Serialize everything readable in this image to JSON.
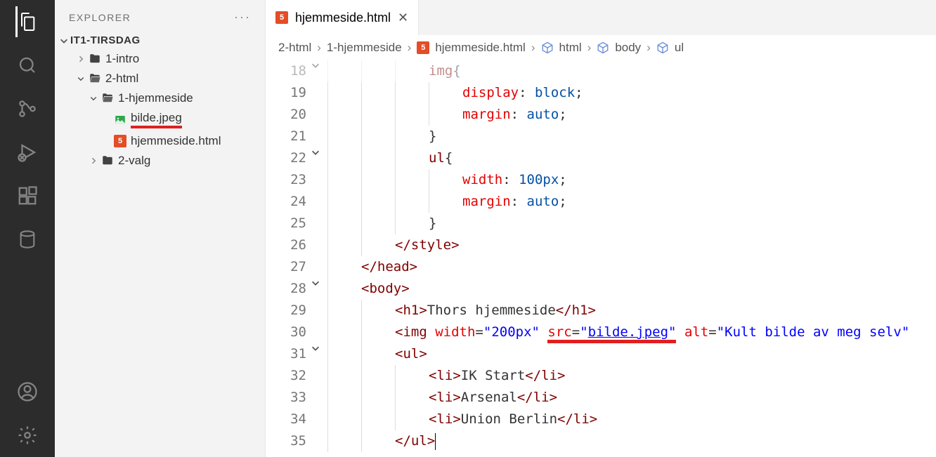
{
  "sidebar": {
    "title": "EXPLORER",
    "root": "IT1-TIRSDAG",
    "items": [
      {
        "label": "1-intro",
        "icon": "folder",
        "depth": 1
      },
      {
        "label": "2-html",
        "icon": "folder-open",
        "depth": 1
      },
      {
        "label": "1-hjemmeside",
        "icon": "folder-open",
        "depth": 2
      },
      {
        "label": "bilde.jpeg",
        "icon": "image",
        "depth": 3,
        "underlined": true
      },
      {
        "label": "hjemmeside.html",
        "icon": "html5",
        "depth": 3
      },
      {
        "label": "2-valg",
        "icon": "folder",
        "depth": 2
      }
    ]
  },
  "tab": {
    "file": "hjemmeside.html"
  },
  "breadcrumb": {
    "parts": [
      "2-html",
      "1-hjemmeside",
      "hjemmeside.html",
      "html",
      "body",
      "ul"
    ]
  },
  "code": {
    "lines": [
      {
        "n": 18,
        "fold": "down",
        "indent": 3,
        "html": "<span class='sel'>img</span><span class='punct'>{</span>",
        "dim": true
      },
      {
        "n": 19,
        "indent": 4,
        "html": "<span class='prop'>display</span><span class='punct'>: </span><span class='pval'>block</span><span class='punct'>;</span>"
      },
      {
        "n": 20,
        "indent": 4,
        "html": "<span class='prop'>margin</span><span class='punct'>: </span><span class='pval'>auto</span><span class='punct'>;</span>"
      },
      {
        "n": 21,
        "indent": 3,
        "html": "<span class='punct'>}</span>"
      },
      {
        "n": 22,
        "fold": "down",
        "indent": 3,
        "html": "<span class='sel'>ul</span><span class='punct'>{</span>"
      },
      {
        "n": 23,
        "indent": 4,
        "html": "<span class='prop'>width</span><span class='punct'>: </span><span class='pval'>100px</span><span class='punct'>;</span>"
      },
      {
        "n": 24,
        "indent": 4,
        "html": "<span class='prop'>margin</span><span class='punct'>: </span><span class='pval'>auto</span><span class='punct'>;</span>"
      },
      {
        "n": 25,
        "indent": 3,
        "html": "<span class='punct'>}</span>"
      },
      {
        "n": 26,
        "indent": 2,
        "html": "<span class='tag'>&lt;/style&gt;</span>"
      },
      {
        "n": 27,
        "indent": 1,
        "html": "<span class='tag'>&lt;/head&gt;</span>"
      },
      {
        "n": 28,
        "fold": "down",
        "indent": 1,
        "html": "<span class='tag'>&lt;body&gt;</span>"
      },
      {
        "n": 29,
        "indent": 2,
        "html": "<span class='tag'>&lt;h1&gt;</span><span class='txt'>Thors hjemmeside</span><span class='tag'>&lt;/h1&gt;</span>"
      },
      {
        "n": 30,
        "indent": 2,
        "html": "<span class='tag'>&lt;img</span> <span class='attr'>width</span><span class='punct'>=</span><span class='val'>\"200px\"</span> <span class='red-underline-img'><span class='attr'>src</span><span class='punct'>=</span><span class='val'>\"<span style='text-decoration:underline'>bilde.jpeg</span>\"</span></span> <span class='attr'>alt</span><span class='punct'>=</span><span class='val'>\"Kult bilde av meg selv\"</span>"
      },
      {
        "n": 31,
        "fold": "down",
        "indent": 2,
        "html": "<span class='tag'>&lt;ul&gt;</span>"
      },
      {
        "n": 32,
        "indent": 3,
        "html": "<span class='tag'>&lt;li&gt;</span><span class='txt'>IK Start</span><span class='tag'>&lt;/li&gt;</span>"
      },
      {
        "n": 33,
        "indent": 3,
        "html": "<span class='tag'>&lt;li&gt;</span><span class='txt'>Arsenal</span><span class='tag'>&lt;/li&gt;</span>"
      },
      {
        "n": 34,
        "indent": 3,
        "html": "<span class='tag'>&lt;li&gt;</span><span class='txt'>Union Berlin</span><span class='tag'>&lt;/li&gt;</span>"
      },
      {
        "n": 35,
        "indent": 2,
        "html": "<span class='tag'>&lt;/ul&gt;</span><span class='cursor'></span>"
      }
    ]
  }
}
